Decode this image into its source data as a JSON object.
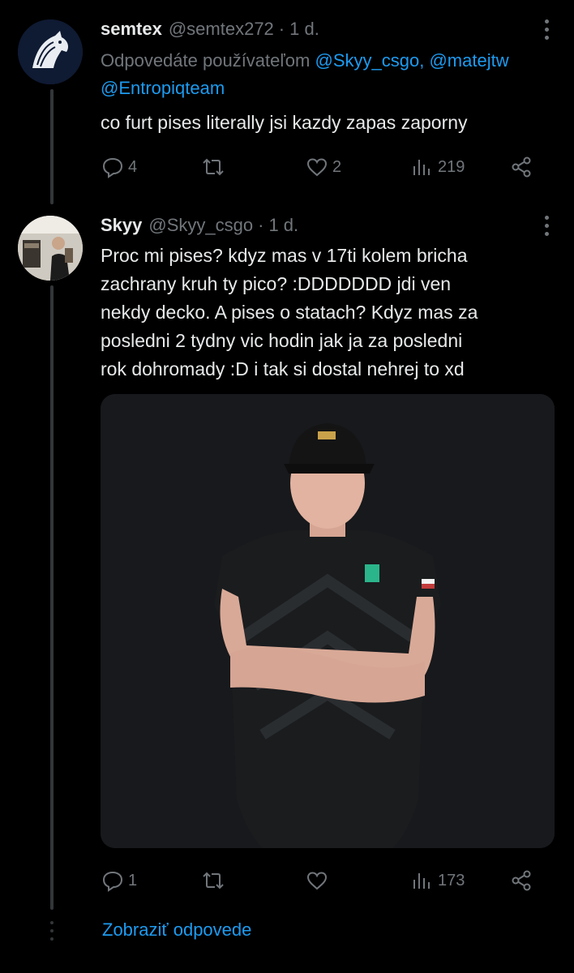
{
  "tweet1": {
    "name": "semtex",
    "handle": "@semtex272",
    "dot": "·",
    "time": "1 d.",
    "reply_prefix": "Odpovedáte používateľom",
    "mention1": "@Skyy_csgo,",
    "mention2": "@matejtw",
    "mention3": "@Entropiqteam",
    "text": "co furt pises literally jsi kazdy zapas zaporny",
    "replies": "4",
    "retweets": "",
    "likes": "2",
    "views": "219"
  },
  "tweet2": {
    "name": "Skyy",
    "handle": "@Skyy_csgo",
    "dot": "·",
    "time": "1 d.",
    "text_lines": [
      "Proc mi pises? kdyz mas v 17ti kolem bricha",
      "zachrany kruh ty pico? :DDDDDDD jdi ven",
      "nekdy decko. A pises o statach? Kdyz mas za",
      "posledni 2 tydny vic hodin jak ja za posledni",
      "rok dohromady :D i tak si dostal nehrej to xd"
    ],
    "replies": "1",
    "retweets": "",
    "likes": "",
    "views": "173"
  },
  "show_replies": "Zobraziť odpovede",
  "colors": {
    "background": "#000000",
    "text": "#e7e9ea",
    "muted": "#71767b",
    "link": "#1d9bf0",
    "thread_line": "#333639"
  },
  "icons": [
    "reply-icon",
    "retweet-icon",
    "like-icon",
    "views-icon",
    "share-icon",
    "more-icon"
  ]
}
